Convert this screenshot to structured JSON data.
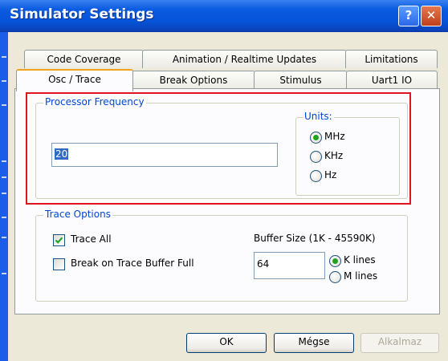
{
  "window": {
    "title": "Simulator Settings",
    "help_glyph": "?",
    "close_glyph": "✕"
  },
  "tabs": {
    "row_back": [
      "Code Coverage",
      "Animation / Realtime  Updates",
      "Limitations"
    ],
    "row_front": [
      "Osc / Trace",
      "Break Options",
      "Stimulus",
      "Uart1  IO"
    ],
    "active": "Osc / Trace"
  },
  "processor_frequency": {
    "label": "Processor  Frequency",
    "value": "20",
    "units_label": "Units:",
    "units": [
      "MHz",
      "KHz",
      "Hz"
    ],
    "selected_unit": "MHz"
  },
  "trace_options": {
    "label": "Trace Options",
    "trace_all_label": "Trace All",
    "trace_all_checked": true,
    "break_label": "Break on Trace Buffer Full",
    "break_checked": false,
    "buffer_label": "Buffer Size  (1K - 45590K)",
    "buffer_value": "64",
    "buffer_units": [
      "K lines",
      "M lines"
    ],
    "selected_buffer_unit": "K lines"
  },
  "buttons": {
    "ok": "OK",
    "cancel": "Mégse",
    "apply": "Alkalmaz"
  },
  "colors": {
    "title_bar": "#0653d8",
    "highlight": "#e0141c",
    "group_label": "#0046d5",
    "radio_dot": "#21a121"
  }
}
